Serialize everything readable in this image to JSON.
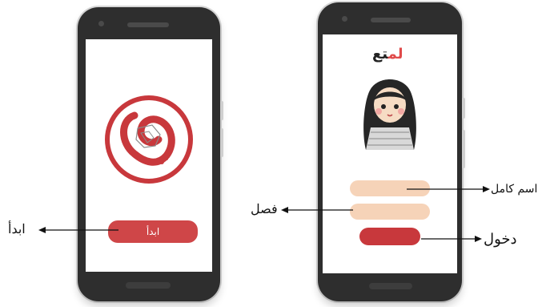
{
  "left_phone": {
    "start_button_label": "ابدأ"
  },
  "right_phone": {
    "brand": {
      "part1": "تع",
      "part2": "لم"
    }
  },
  "annotations": {
    "start": "ابدأ",
    "full_name": "اسم كامل",
    "class": "فصل",
    "login": "دخول"
  },
  "colors": {
    "accent_red": "#cf4648",
    "field_peach": "#f6d3b8",
    "phone_body": "#2e2e2e"
  }
}
